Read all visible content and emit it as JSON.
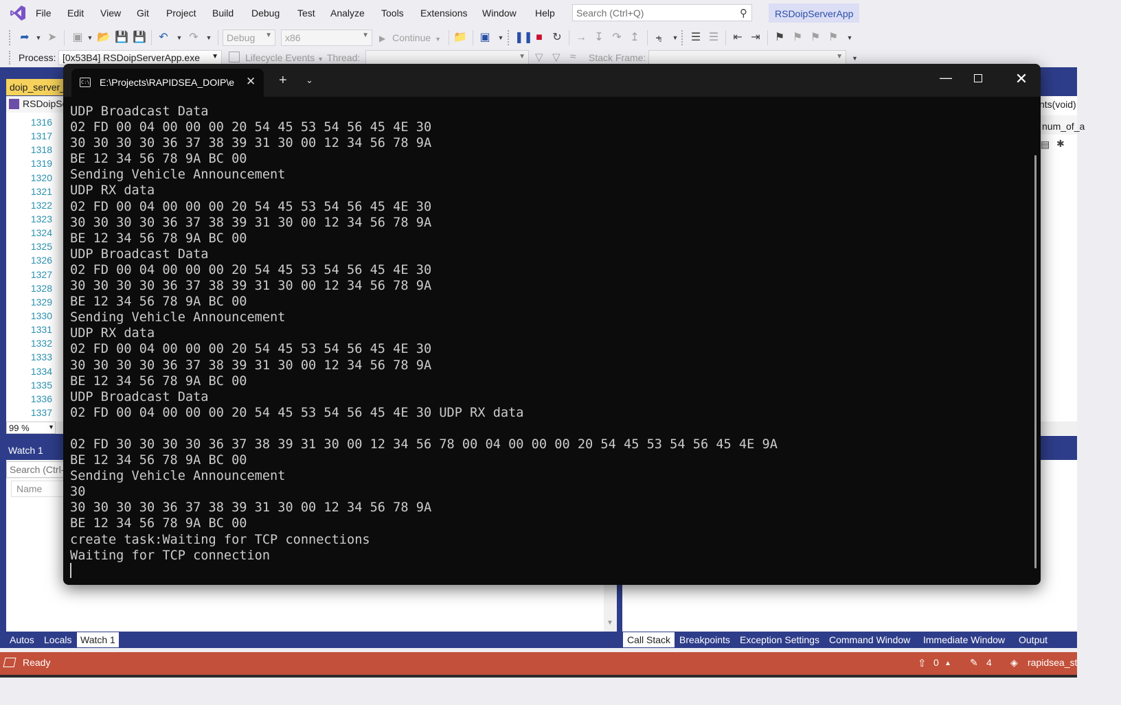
{
  "menubar": {
    "items": [
      "File",
      "Edit",
      "View",
      "Git",
      "Project",
      "Build",
      "Debug",
      "Test",
      "Analyze",
      "Tools",
      "Extensions",
      "Window",
      "Help"
    ],
    "search_placeholder": "Search (Ctrl+Q)",
    "solution_name": "RSDoipServerApp"
  },
  "toolbar": {
    "configuration": "Debug",
    "platform": "x86",
    "continue_label": "Continue",
    "process_label": "Process:",
    "process_value": "[0x53B4] RSDoipServerApp.exe",
    "lifecycle_label": "Lifecycle Events",
    "thread_label": "Thread:",
    "stack_frame_label": "Stack Frame:"
  },
  "editor": {
    "doc_tab": "doip_server_",
    "nav_project": "RSDoipSe",
    "line_numbers": [
      "1316",
      "1317",
      "1318",
      "1319",
      "1320",
      "1321",
      "1322",
      "1323",
      "1324",
      "1325",
      "1326",
      "1327",
      "1328",
      "1329",
      "1330",
      "1331",
      "1332",
      "1333",
      "1334",
      "1335",
      "1336",
      "1337"
    ],
    "zoom": "99 %",
    "right_func": "nts(void)",
    "right_enum": "num_of_a"
  },
  "watch": {
    "title": "Watch 1",
    "search_placeholder": "Search (Ctrl-",
    "name_column": "Name",
    "tabs": [
      "Autos",
      "Locals",
      "Watch 1"
    ],
    "active_tab": "Watch 1"
  },
  "right_panel": {
    "tabs": [
      "Call Stack",
      "Breakpoints",
      "Exception Settings",
      "Command Window",
      "Immediate Window",
      "Output"
    ],
    "active_tab": "Call Stack"
  },
  "statusbar": {
    "status": "Ready",
    "push_count": "0",
    "pencil_count": "4",
    "repo": "rapidsea_st"
  },
  "console": {
    "tab_title": "E:\\Projects\\RAPIDSEA_DOIP\\e",
    "lines": [
      "UDP Broadcast Data",
      "02 FD 00 04 00 00 00 20 54 45 53 54 56 45 4E 30",
      "30 30 30 30 36 37 38 39 31 30 00 12 34 56 78 9A",
      "BE 12 34 56 78 9A BC 00",
      "Sending Vehicle Announcement",
      "UDP RX data",
      "02 FD 00 04 00 00 00 20 54 45 53 54 56 45 4E 30",
      "30 30 30 30 36 37 38 39 31 30 00 12 34 56 78 9A",
      "BE 12 34 56 78 9A BC 00",
      "UDP Broadcast Data",
      "02 FD 00 04 00 00 00 20 54 45 53 54 56 45 4E 30",
      "30 30 30 30 36 37 38 39 31 30 00 12 34 56 78 9A",
      "BE 12 34 56 78 9A BC 00",
      "Sending Vehicle Announcement",
      "UDP RX data",
      "02 FD 00 04 00 00 00 20 54 45 53 54 56 45 4E 30",
      "30 30 30 30 36 37 38 39 31 30 00 12 34 56 78 9A",
      "BE 12 34 56 78 9A BC 00",
      "UDP Broadcast Data",
      "02 FD 00 04 00 00 00 20 54 45 53 54 56 45 4E 30 UDP RX data",
      "",
      "02 FD 30 30 30 30 36 37 38 39 31 30 00 12 34 56 78 00 04 00 00 00 20 54 45 53 54 56 45 4E 9A",
      "BE 12 34 56 78 9A BC 00",
      "Sending Vehicle Announcement",
      "30",
      "30 30 30 30 36 37 38 39 31 30 00 12 34 56 78 9A",
      "BE 12 34 56 78 9A BC 00",
      "create task:Waiting for TCP connections",
      "Waiting for TCP connection"
    ]
  }
}
